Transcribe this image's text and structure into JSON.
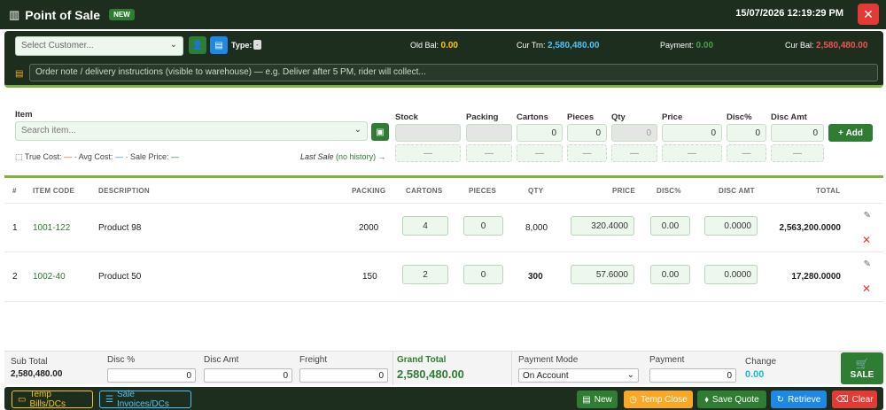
{
  "header": {
    "title": "Point of Sale",
    "badge": "NEW",
    "datetime": "15/07/2026 12:19:29 PM",
    "close_icon": "close-icon"
  },
  "customer": {
    "select_placeholder": "Select Customer...",
    "type_label": "Type:",
    "type_value": "-",
    "old_bal_label": "Old Bal:",
    "old_bal_value": "0.00",
    "cur_trn_label": "Cur Trn:",
    "cur_trn_value": "2,580,480.00",
    "payment_label": "Payment:",
    "payment_value": "0.00",
    "cur_bal_label": "Cur Bal:",
    "cur_bal_value": "2,580,480.00",
    "note_placeholder": "Order note / delivery instructions (visible to warehouse) — e.g. Deliver after 5 PM, rider will collect..."
  },
  "entry": {
    "item_label": "Item",
    "search_placeholder": "Search item...",
    "stock_label": "Stock",
    "packing_label": "Packing",
    "cartons_label": "Cartons",
    "pieces_label": "Pieces",
    "qty_label": "Qty",
    "price_label": "Price",
    "disc_pct_label": "Disc%",
    "disc_amt_label": "Disc Amt",
    "cartons_value": "0",
    "pieces_value": "0",
    "qty_value": "0",
    "price_value": "0",
    "disc_pct_value": "0",
    "disc_amt_value": "0",
    "dash": "—",
    "add_label": "Add",
    "true_cost": "True Cost:",
    "avg_cost": "· Avg Cost:",
    "sale_price": "· Sale Price:",
    "last_sale_label": "Last Sale",
    "last_sale_value": "(no history) →"
  },
  "table": {
    "columns": [
      "#",
      "ITEM CODE",
      "DESCRIPTION",
      "PACKING",
      "CARTONS",
      "PIECES",
      "QTY",
      "PRICE",
      "DISC%",
      "DISC AMT",
      "TOTAL"
    ],
    "rows": [
      {
        "n": "1",
        "code": "1001-122",
        "desc": "Product 98",
        "packing": "2000",
        "cartons": "4",
        "pieces": "0",
        "qty": "8,000",
        "price": "320.4000",
        "disc_pct": "0.00",
        "disc_amt": "0.0000",
        "total": "2,563,200.0000"
      },
      {
        "n": "2",
        "code": "1002-40",
        "desc": "Product 50",
        "packing": "150",
        "cartons": "2",
        "pieces": "0",
        "qty": "300",
        "price": "57.6000",
        "disc_pct": "0.00",
        "disc_amt": "0.0000",
        "total": "17,280.0000"
      }
    ]
  },
  "totals": {
    "sub_total_label": "Sub Total",
    "sub_total_value": "2,580,480.00",
    "disc_pct_label": "Disc %",
    "disc_pct_value": "0",
    "disc_amt_label": "Disc Amt",
    "disc_amt_value": "0",
    "freight_label": "Freight",
    "freight_value": "0",
    "grand_total_label": "Grand Total",
    "grand_total_value": "2,580,480.00",
    "payment_mode_label": "Payment Mode",
    "payment_mode_value": "On Account",
    "payment_label": "Payment",
    "payment_value": "0",
    "change_label": "Change",
    "change_value": "0.00",
    "sale_label": "SALE"
  },
  "footer": {
    "temp_bills": "Temp Bills/DCs",
    "sale_invoices": "Sale Invoices/DCs",
    "new": "New",
    "temp_close": "Temp Close",
    "save_quote": "Save Quote",
    "retrieve": "Retrieve",
    "clear": "Clear"
  },
  "colors": {
    "dark": "#1e2e1e",
    "accent_green": "#2e7d32",
    "light_green": "#7cb342",
    "yellow": "#f9c80e",
    "red": "#e53935",
    "blue": "#1e88e5",
    "orange": "#f9a825"
  }
}
